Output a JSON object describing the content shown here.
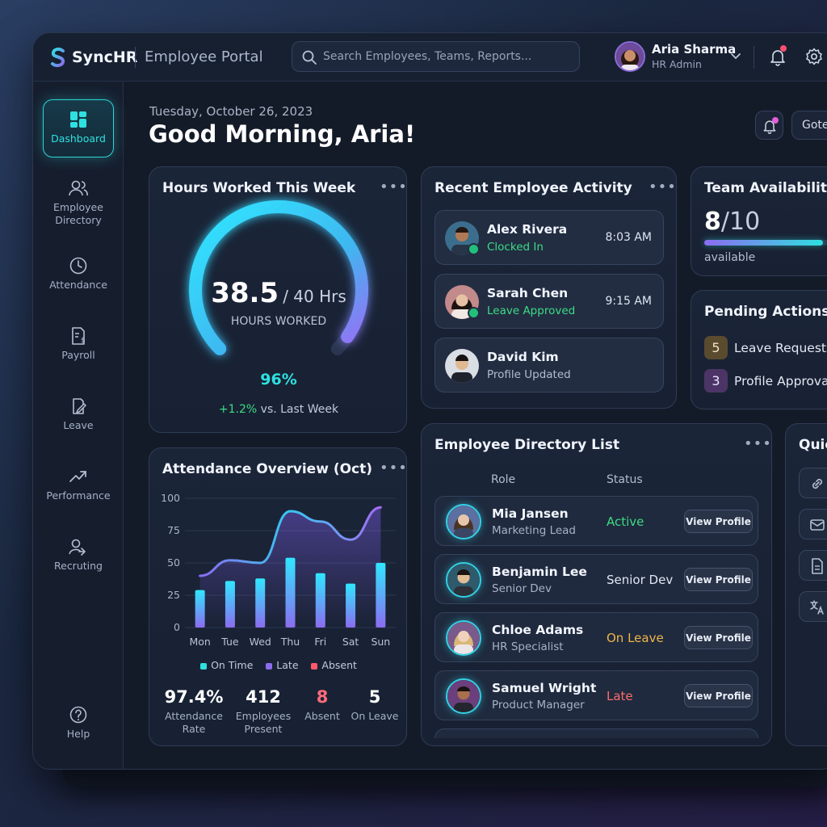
{
  "header": {
    "brand": "SyncHR",
    "portal": "Employee Portal",
    "search_placeholder": "Search Employees, Teams, Reports...",
    "user_name": "Aria Sharma",
    "user_role": "HR Admin"
  },
  "sidebar": {
    "items": [
      {
        "label": "Dashboard"
      },
      {
        "label": "Employee Directory"
      },
      {
        "label": "Attendance"
      },
      {
        "label": "Payroll"
      },
      {
        "label": "Leave"
      },
      {
        "label": "Performance"
      },
      {
        "label": "Recruting"
      }
    ],
    "help": "Help"
  },
  "main": {
    "date": "Tuesday, October 26, 2023",
    "greeting": "Good Morning, Aria!",
    "header_button": "Gote"
  },
  "hours_card": {
    "title": "Hours Worked This Week",
    "value": "38.5",
    "target": "/ 40 Hrs",
    "label": "HOURS WORKED",
    "percent": "96%",
    "progress": 0.96,
    "delta": "+1.2%",
    "delta_suffix": " vs. Last Week"
  },
  "activity_card": {
    "title": "Recent Employee Activity",
    "items": [
      {
        "name": "Alex Rivera",
        "status": "Clocked In",
        "time": "8:03 AM"
      },
      {
        "name": "Sarah Chen",
        "status": "Leave Approved",
        "time": "9:15 AM"
      },
      {
        "name": "David Kim",
        "status": "Profile Updated",
        "time": ""
      }
    ]
  },
  "availability_card": {
    "title": "Team Availability",
    "available": "8",
    "total": "/10",
    "fraction": 0.8,
    "label": "available"
  },
  "pending_card": {
    "title": "Pending Actions",
    "items": [
      {
        "count": "5",
        "label": "Leave Requests"
      },
      {
        "count": "3",
        "label": "Profile Approval"
      }
    ]
  },
  "attendance_card": {
    "title": "Attendance Overview (Oct)",
    "legend": [
      "On Time",
      "Late",
      "Absent"
    ],
    "stats": [
      {
        "value": "97.4%",
        "label": "Attendance Rate"
      },
      {
        "value": "412",
        "label": "Employees Present"
      },
      {
        "value": "8",
        "label": "Absent"
      },
      {
        "value": "5",
        "label": "On Leave"
      }
    ]
  },
  "chart_data": {
    "type": "bar",
    "categories": [
      "Mon",
      "Tue",
      "Wed",
      "Thu",
      "Fri",
      "Sat",
      "Sun"
    ],
    "yticks": [
      0,
      25,
      50,
      75,
      100
    ],
    "ylim": [
      0,
      100
    ],
    "series": [
      {
        "name": "On Time",
        "values": [
          29,
          36,
          38,
          54,
          42,
          34,
          50
        ]
      },
      {
        "values": [
          40,
          52,
          50,
          90,
          82,
          68,
          93
        ]
      }
    ],
    "legend_placement": "bottom",
    "grid": true
  },
  "directory_card": {
    "title": "Employee Directory List",
    "col_role": "Role",
    "col_status": "Status",
    "button_label": "View Profile",
    "rows": [
      {
        "name": "Mia Jansen",
        "role": "Marketing Lead",
        "status": "Active"
      },
      {
        "name": "Benjamin Lee",
        "role": "Senior Dev",
        "status": "Senior Dev"
      },
      {
        "name": "Chloe Adams",
        "role": "HR Specialist",
        "status": "On Leave"
      },
      {
        "name": "Samuel Wright",
        "role": "Product Manager",
        "status": "Late"
      }
    ]
  },
  "quick_card": {
    "title": "Quic"
  },
  "colors": {
    "accent": "#2fe0e0",
    "purple": "#8b6cf0",
    "active": "#3ddc84",
    "on_leave": "#f0b44a",
    "late": "#ff6b6b",
    "absent": "#ff5a6a"
  }
}
